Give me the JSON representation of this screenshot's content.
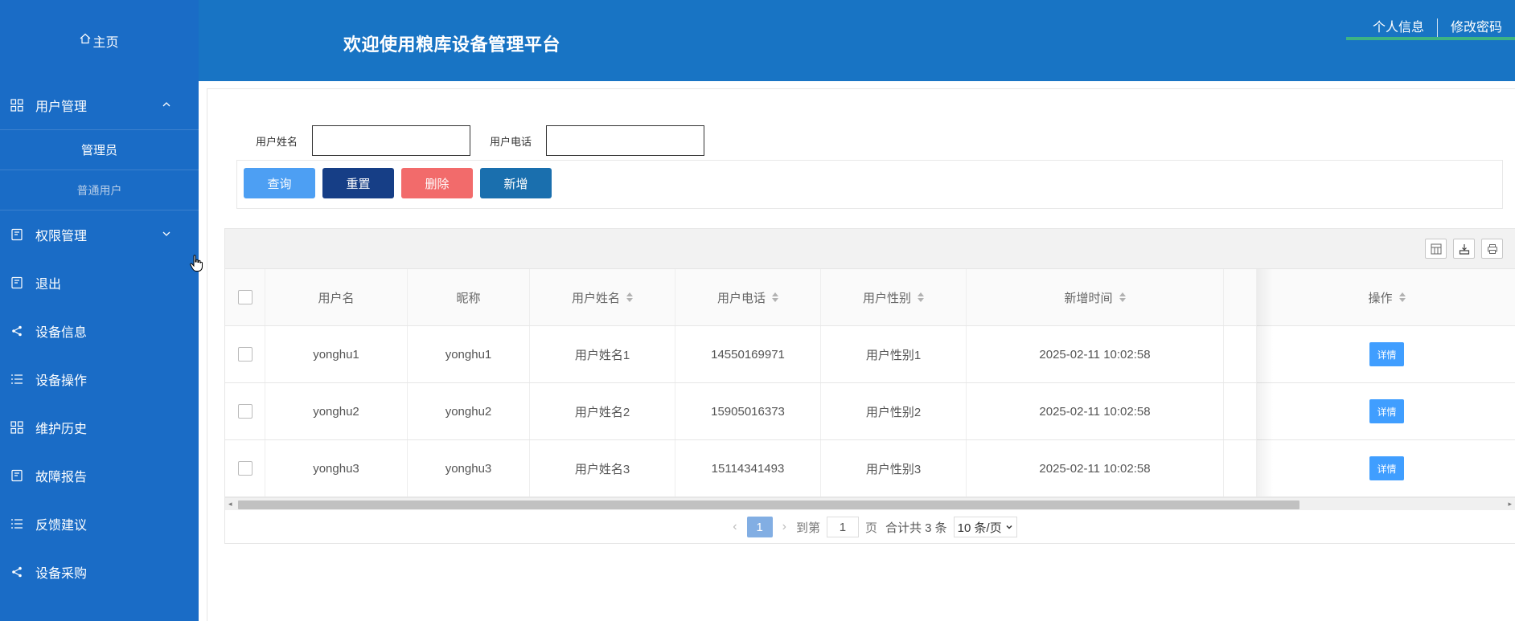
{
  "header": {
    "home_label": "主页",
    "title": "欢迎使用粮库设备管理平台",
    "links": [
      "个人信息",
      "修改密码"
    ]
  },
  "sidebar": {
    "items": [
      {
        "label": "用户管理",
        "icon": "grid-icon",
        "expanded": true,
        "children": [
          "管理员",
          "普通用户"
        ]
      },
      {
        "label": "权限管理",
        "icon": "book-icon",
        "expanded": false
      },
      {
        "label": "退出",
        "icon": "book-icon"
      },
      {
        "label": "设备信息",
        "icon": "share-icon"
      },
      {
        "label": "设备操作",
        "icon": "list-icon"
      },
      {
        "label": "维护历史",
        "icon": "grid-icon"
      },
      {
        "label": "故障报告",
        "icon": "book-icon"
      },
      {
        "label": "反馈建议",
        "icon": "list-icon"
      },
      {
        "label": "设备采购",
        "icon": "share-icon"
      }
    ]
  },
  "search": {
    "name_label": "用户姓名",
    "phone_label": "用户电话",
    "name_value": "",
    "phone_value": ""
  },
  "buttons": {
    "query": "查询",
    "reset": "重置",
    "delete": "删除",
    "add": "新增"
  },
  "colors": {
    "header": "#1874c4",
    "sidebar": "#1a6cc6",
    "query": "#4d9ff3",
    "reset": "#163e86",
    "delete": "#f26b6b",
    "add": "#1a6fae",
    "detail": "#409eff"
  },
  "table": {
    "columns": [
      "用户名",
      "昵称",
      "用户姓名",
      "用户电话",
      "用户性别",
      "新增时间",
      "操作"
    ],
    "rows": [
      [
        "yonghu1",
        "yonghu1",
        "用户姓名1",
        "14550169971",
        "用户性别1",
        "2025-02-11 10:02:58"
      ],
      [
        "yonghu2",
        "yonghu2",
        "用户姓名2",
        "15905016373",
        "用户性别2",
        "2025-02-11 10:02:58"
      ],
      [
        "yonghu3",
        "yonghu3",
        "用户姓名3",
        "15114341493",
        "用户性别3",
        "2025-02-11 10:02:58"
      ]
    ],
    "detail_label": "详情"
  },
  "pager": {
    "current": "1",
    "goto_label": "到第",
    "goto_value": "1",
    "page_unit": "页",
    "total": "合计共 3 条",
    "size": "10 条/页"
  }
}
